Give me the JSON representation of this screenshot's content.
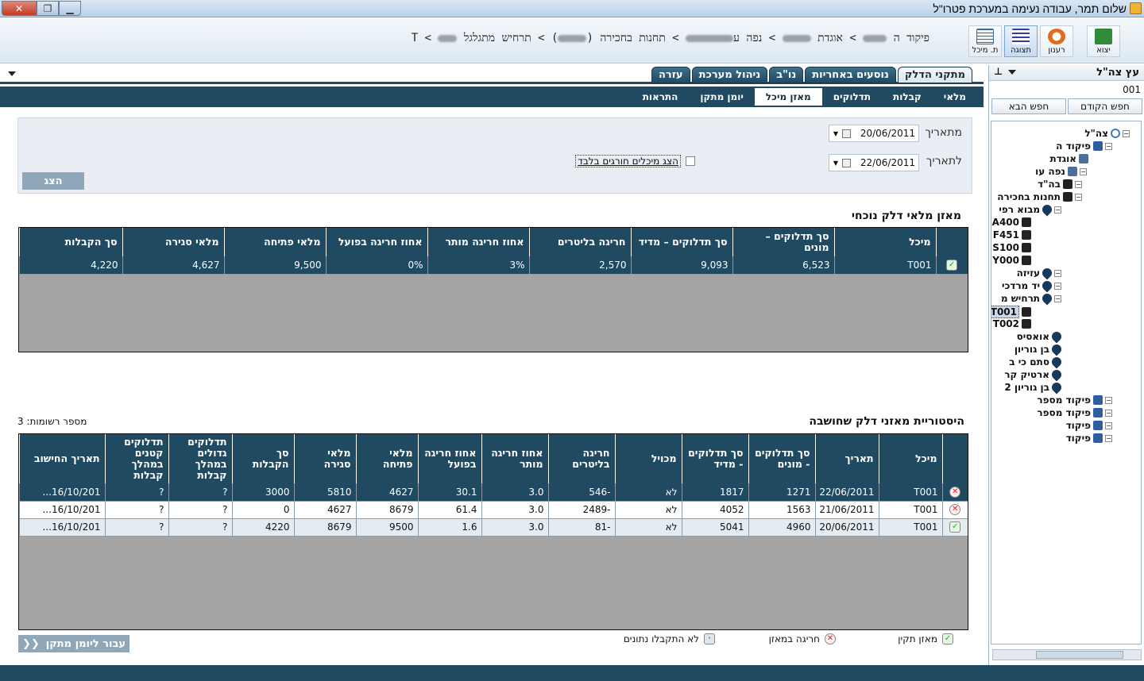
{
  "window": {
    "title": "שלום תמר, עבודה נעימה במערכת פטרו\"ל"
  },
  "breadcrumb": {
    "p1": "פיקוד ה",
    "p2": "אוגדת",
    "p3": "נפה ע",
    "p4": "תחנות בחכירה (",
    "p5": ")",
    "p6": "תרחיש מתגלגל",
    "p7": "T"
  },
  "toolbar": {
    "exit": "יצוא",
    "refresh": "רענון",
    "display": "תצוגה",
    "tank": "ת. מיכל"
  },
  "top_tabs": [
    "מתקני הדלק",
    "נוסעים באחריות",
    "נו\"ב",
    "ניהול מערכת",
    "עזרה"
  ],
  "sub_tabs": [
    "מלאי",
    "קבלות",
    "תדלוקים",
    "מאזן מיכל",
    "יומן מתקן",
    "התראות"
  ],
  "filter": {
    "from_label": "מתאריך",
    "from_value": "20/06/2011",
    "to_label": "לתאריך",
    "to_value": "22/06/2011",
    "exceptions_label": "הצג מיכלים חורגים בלבד",
    "show_button": "הצג"
  },
  "current": {
    "title": "מאזן מלאי דלק נוכחי",
    "headers": [
      "מיכל",
      "סך תדלוקים – מונים",
      "סך תדלוקים – מדיד",
      "חריגה בליטרים",
      "אחוז חריגה מותר",
      "אחוז חריגה בפועל",
      "מלאי פתיחה",
      "מלאי סגירה",
      "סך הקבלות"
    ],
    "rows": [
      {
        "status": "ok",
        "cells": [
          "T001",
          "6,523",
          "9,093",
          "2,570",
          "3%",
          "0%",
          "9,500",
          "4,627",
          "4,220"
        ]
      }
    ]
  },
  "history": {
    "title": "היסטוריית מאזני דלק שחושבה",
    "count_label": "מספר רשומות: 3",
    "headers": [
      "מיכל",
      "תאריך",
      "סך תדלוקים - מונים",
      "סך תדלוקים - מדיד",
      "מכויל",
      "חריגה בליטרים",
      "אחוז חריגה מותר",
      "אחוז חריגה בפועל",
      "מלאי פתיחה",
      "מלאי סגירה",
      "סך הקבלות",
      "תדלוקים גדולים במהלך קבלות",
      "תדלוקים קטנים במהלך קבלות",
      "תאריך החישוב"
    ],
    "rows": [
      {
        "status": "err",
        "cells": [
          "T001",
          "22/06/2011",
          "1271",
          "1817",
          "לא",
          "-546",
          "3.0",
          "30.1",
          "4627",
          "5810",
          "3000",
          "?",
          "?",
          "16/10/201..."
        ]
      },
      {
        "status": "err",
        "cells": [
          "T001",
          "21/06/2011",
          "1563",
          "4052",
          "לא",
          "-2489",
          "3.0",
          "61.4",
          "8679",
          "4627",
          "0",
          "?",
          "?",
          "16/10/201..."
        ]
      },
      {
        "status": "ok",
        "cells": [
          "T001",
          "20/06/2011",
          "4960",
          "5041",
          "לא",
          "-81",
          "3.0",
          "1.6",
          "9500",
          "8679",
          "4220",
          "?",
          "?",
          "16/10/201..."
        ]
      }
    ]
  },
  "legend": {
    "ok": "מאזן תקין",
    "err": "חריגה במאזן",
    "na": "לא התקבלו נתונים"
  },
  "nav_button": "עבור ליומן מתקן",
  "sidebar": {
    "title": "עץ צה\"ל",
    "code": "001",
    "prev_button": "חפש הקודם",
    "next_button": "חפש הבא",
    "tree": [
      "צה\"ל",
      "פיקוד ה",
      "אוגדת",
      "נפה עו",
      "בה\"ד",
      "תחנות בחכירה",
      "מבוא רפי",
      "A400",
      "F451",
      "S100",
      "Y000",
      "עזיזה",
      "יד מרדכי",
      "תרחיש מ",
      "T001",
      "T002",
      "אואסיס",
      "בן גוריון",
      "סתם כי ב",
      "ארטיק קר",
      "בן גוריון 2",
      "פיקוד מספר",
      "פיקוד מספר",
      "פיקוד",
      "פיקוד"
    ]
  }
}
